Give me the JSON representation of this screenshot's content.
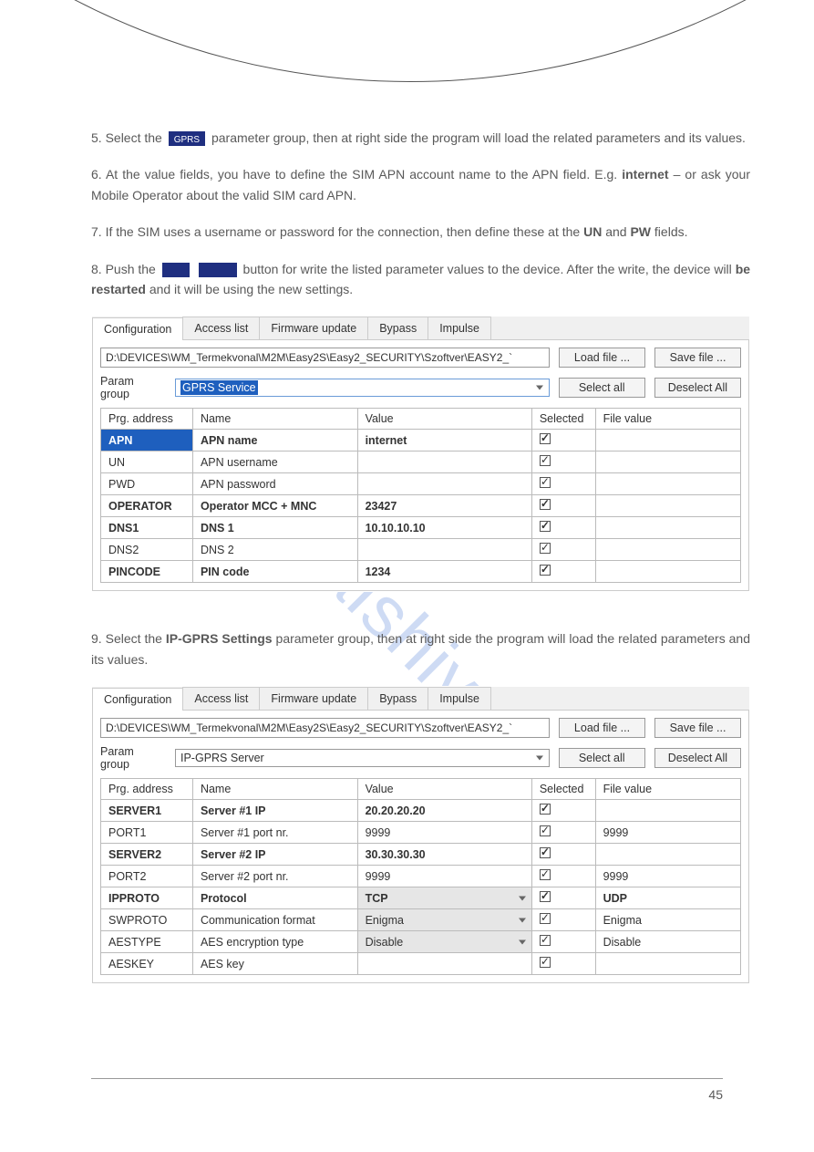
{
  "text": {
    "p1_pre": "5. Select the ",
    "p1_mid": " parameter group, then at right side the program will load the related parameters and its values.",
    "p2": "6. At the value fields, you have to define the SIM APN account name to the APN field. E.g. ",
    "p2_apn": "internet",
    "p2_tail": " – or ask your Mobile Operator about the valid SIM card APN.",
    "p3_pre": "7. If the SIM uses a username or password for the connection, then define these at the ",
    "p3_un": "UN",
    "p3_and": " and ",
    "p3_pw": "PW",
    "p3_tail": " fields.",
    "p4_pre": "8. Push the ",
    "p4_mid": " button for write the listed parameter values to the device. After the write, the device will ",
    "p4_restart": "be restarted",
    "p4_tail": " and it will be using the new settings.",
    "p5_pre": "9. Select the ",
    "p5_grp": "IP-GPRS Settings",
    "p5_tail": " parameter group, then at right side the program will load the related parameters and its values."
  },
  "icon": {
    "write": "Write",
    "gprs": "GPRS"
  },
  "panel": {
    "tabs": [
      "Configuration",
      "Access list",
      "Firmware update",
      "Bypass",
      "Impulse"
    ],
    "path": "D:\\DEVICES\\WM_Termekvonal\\M2M\\Easy2S\\Easy2_SECURITY\\Szoftver\\EASY2_`",
    "btn_load": "Load file ...",
    "btn_save": "Save file ...",
    "btn_selall": "Select all",
    "btn_desel": "Deselect All",
    "label_pg": "Param group",
    "pg1": "GPRS Service",
    "pg2": "IP-GPRS Server",
    "headers": [
      "Prg. address",
      "Name",
      "Value",
      "Selected",
      "File value"
    ]
  },
  "table1": [
    {
      "addr": "APN",
      "name": "APN name",
      "value": "internet",
      "sel": true,
      "fv": "",
      "bold": true,
      "hi": true
    },
    {
      "addr": "UN",
      "name": "APN username",
      "value": "",
      "sel": true,
      "fv": "",
      "bold": false
    },
    {
      "addr": "PWD",
      "name": "APN password",
      "value": "",
      "sel": true,
      "fv": "",
      "bold": false
    },
    {
      "addr": "OPERATOR",
      "name": "Operator MCC + MNC",
      "value": "23427",
      "sel": true,
      "fv": "",
      "bold": true
    },
    {
      "addr": "DNS1",
      "name": "DNS 1",
      "value": "10.10.10.10",
      "sel": true,
      "fv": "",
      "bold": true
    },
    {
      "addr": "DNS2",
      "name": "DNS 2",
      "value": "",
      "sel": true,
      "fv": "",
      "bold": false
    },
    {
      "addr": "PINCODE",
      "name": "PIN code",
      "value": "1234",
      "sel": true,
      "fv": "",
      "bold": true
    }
  ],
  "table2": [
    {
      "addr": "SERVER1",
      "name": "Server #1 IP",
      "value": "20.20.20.20",
      "sel": true,
      "fv": "",
      "bold": true
    },
    {
      "addr": "PORT1",
      "name": "Server #1 port nr.",
      "value": "9999",
      "sel": true,
      "fv": "9999",
      "bold": false
    },
    {
      "addr": "SERVER2",
      "name": "Server #2 IP",
      "value": "30.30.30.30",
      "sel": true,
      "fv": "",
      "bold": true
    },
    {
      "addr": "PORT2",
      "name": "Server #2 port nr.",
      "value": "9999",
      "sel": true,
      "fv": "9999",
      "bold": false
    },
    {
      "addr": "IPPROTO",
      "name": "Protocol",
      "value": "TCP",
      "sel": true,
      "fv": "UDP",
      "bold": true,
      "dropdown": true
    },
    {
      "addr": "SWPROTO",
      "name": "Communication format",
      "value": "Enigma",
      "sel": true,
      "fv": "Enigma",
      "bold": false,
      "dropdown": true
    },
    {
      "addr": "AESTYPE",
      "name": "AES encryption type",
      "value": "Disable",
      "sel": true,
      "fv": "Disable",
      "bold": false,
      "dropdown": true
    },
    {
      "addr": "AESKEY",
      "name": "AES key",
      "value": "",
      "sel": true,
      "fv": "",
      "bold": false
    }
  ],
  "watermark": "manualshive.com",
  "page_no": "45"
}
